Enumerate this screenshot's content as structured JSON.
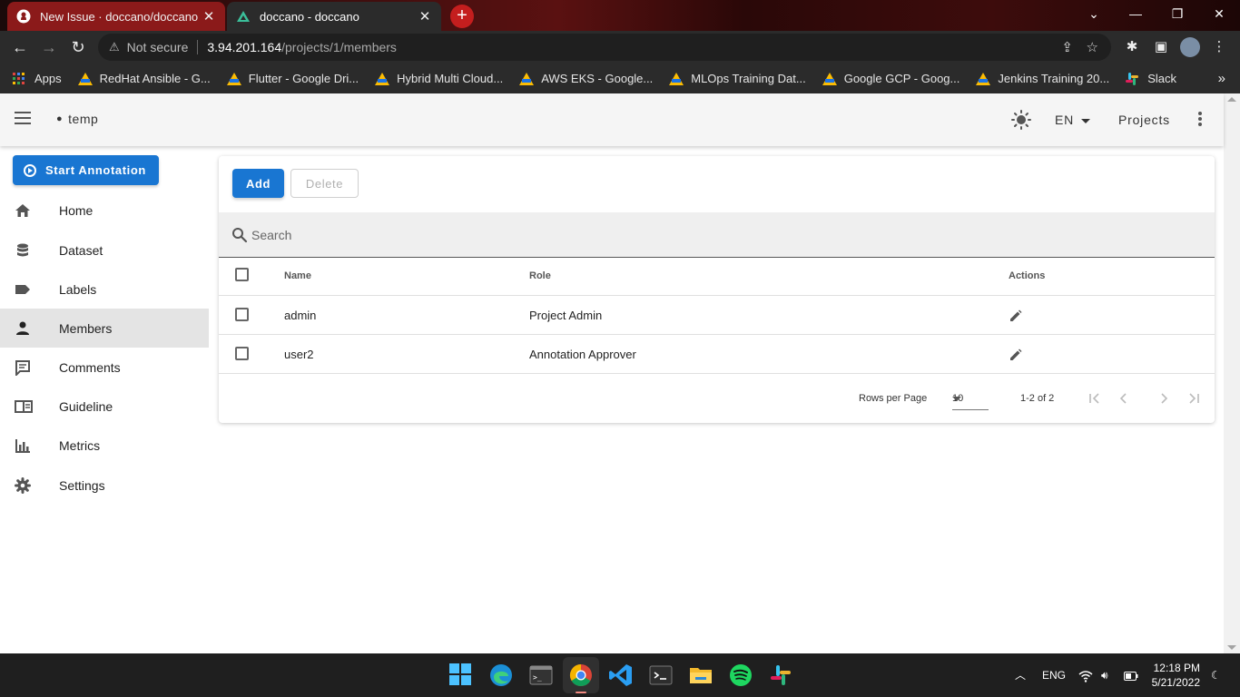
{
  "browser": {
    "tabs": [
      {
        "title": "New Issue · doccano/doccano",
        "icon": "github-icon"
      },
      {
        "title": "doccano - doccano",
        "icon": "doccano-icon"
      }
    ],
    "address": {
      "security": "Not secure",
      "host": "3.94.201.164",
      "path": "/projects/1/members"
    },
    "bookmarks": [
      {
        "label": "Apps",
        "icon": "apps-grid-icon"
      },
      {
        "label": "RedHat Ansible - G...",
        "icon": "google-drive-icon"
      },
      {
        "label": "Flutter - Google Dri...",
        "icon": "google-drive-icon"
      },
      {
        "label": "Hybrid Multi Cloud...",
        "icon": "google-drive-icon"
      },
      {
        "label": "AWS EKS - Google...",
        "icon": "google-drive-icon"
      },
      {
        "label": "MLOps Training Dat...",
        "icon": "google-drive-icon"
      },
      {
        "label": "Google GCP - Goog...",
        "icon": "google-drive-icon"
      },
      {
        "label": "Jenkins Training 20...",
        "icon": "google-drive-icon"
      },
      {
        "label": "Slack",
        "icon": "slack-icon"
      }
    ]
  },
  "appbar": {
    "project_name": "temp",
    "language": "EN",
    "projects_label": "Projects"
  },
  "sidebar": {
    "start_label": "Start Annotation",
    "items": [
      {
        "label": "Home",
        "icon": "home-icon"
      },
      {
        "label": "Dataset",
        "icon": "database-icon"
      },
      {
        "label": "Labels",
        "icon": "label-icon"
      },
      {
        "label": "Members",
        "icon": "account-icon",
        "active": true
      },
      {
        "label": "Comments",
        "icon": "comment-icon"
      },
      {
        "label": "Guideline",
        "icon": "book-icon"
      },
      {
        "label": "Metrics",
        "icon": "chart-icon"
      },
      {
        "label": "Settings",
        "icon": "gear-icon"
      }
    ]
  },
  "members": {
    "add_label": "Add",
    "delete_label": "Delete",
    "search_placeholder": "Search",
    "columns": {
      "name": "Name",
      "role": "Role",
      "actions": "Actions"
    },
    "rows": [
      {
        "name": "admin",
        "role": "Project Admin"
      },
      {
        "name": "user2",
        "role": "Annotation Approver"
      }
    ],
    "footer": {
      "rows_per_page_label": "Rows per Page",
      "rows_per_page": "10",
      "range": "1-2 of 2"
    }
  },
  "taskbar": {
    "language": "ENG",
    "time": "12:18 PM",
    "date": "5/21/2022"
  },
  "colors": {
    "primary": "#1976d2",
    "active_nav": "#e4e4e4",
    "appbar": "#f5f5f5"
  }
}
